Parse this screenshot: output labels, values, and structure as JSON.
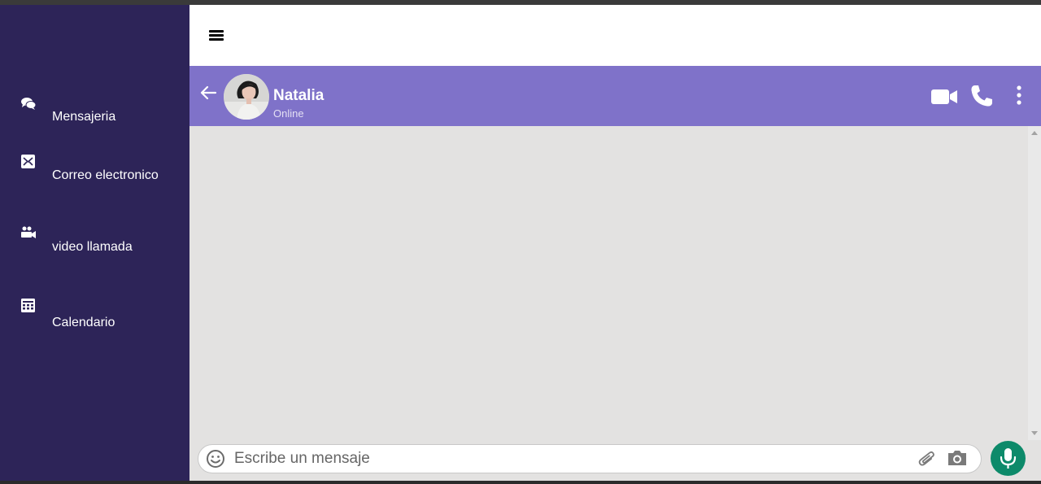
{
  "sidebar": {
    "items": [
      {
        "label": "Mensajeria",
        "icon": "chat-bubbles-icon"
      },
      {
        "label": "Correo electronico",
        "icon": "mail-icon"
      },
      {
        "label": "video llamada",
        "icon": "video-call-icon"
      },
      {
        "label": "Calendario",
        "icon": "calendar-icon"
      }
    ]
  },
  "topbar": {
    "menu_icon": "hamburger-icon"
  },
  "chat": {
    "contact_name": "Natalia",
    "status": "Online",
    "icons": [
      "back-arrow-icon",
      "video-camera-icon",
      "phone-icon",
      "more-vertical-icon"
    ]
  },
  "composer": {
    "placeholder": "Escribe un mensaje",
    "icons": [
      "emoji-icon",
      "paperclip-icon",
      "camera-icon",
      "microphone-icon"
    ]
  },
  "colors": {
    "sidebar_bg": "#2d2458",
    "header_bg": "#7f72c9",
    "chat_bg": "#e3e2e1",
    "mic_button": "#0d8a6a"
  }
}
